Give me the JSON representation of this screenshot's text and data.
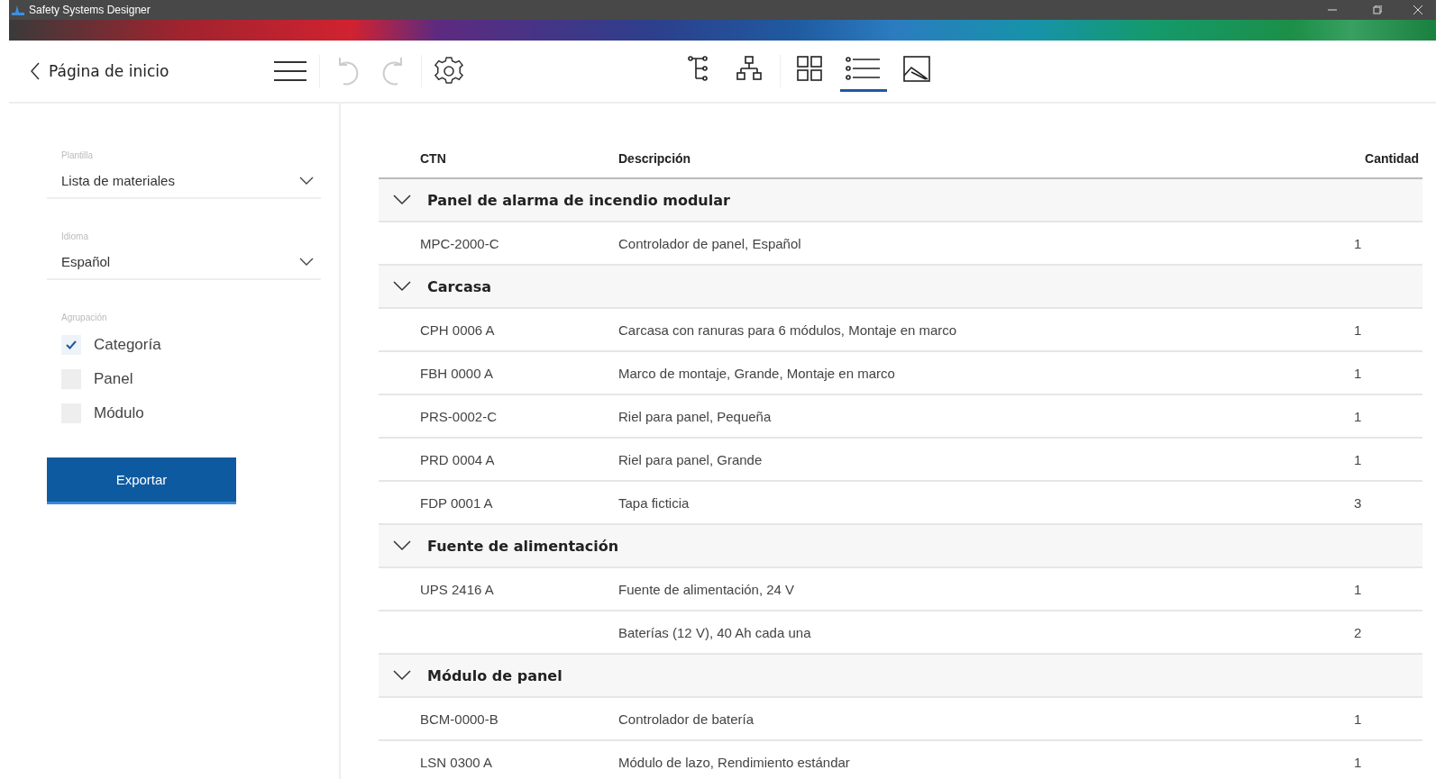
{
  "window": {
    "title": "Safety Systems Designer"
  },
  "toolbar": {
    "back": "Página de inicio",
    "views": [
      {
        "kind": "tree",
        "selected": false
      },
      {
        "kind": "hierarchy",
        "selected": false
      },
      {
        "kind": "grid",
        "selected": false
      },
      {
        "kind": "list",
        "selected": true
      },
      {
        "kind": "image",
        "selected": false
      }
    ]
  },
  "sidebar": {
    "fields": [
      {
        "label": "Plantilla",
        "value": "Lista de materiales"
      },
      {
        "label": "Idioma",
        "value": "Español"
      }
    ],
    "grouping": {
      "label": "Agrupación",
      "options": [
        {
          "label": "Categoría",
          "checked": true
        },
        {
          "label": "Panel",
          "checked": false
        },
        {
          "label": "Módulo",
          "checked": false
        }
      ]
    },
    "export_button": "Exportar"
  },
  "table": {
    "columns": [
      "CTN",
      "Descripción",
      "Cantidad"
    ],
    "groups": [
      {
        "title": "Panel de alarma de incendio modular",
        "expanded": true,
        "rows": [
          [
            "MPC-2000-C",
            "Controlador de panel, Español",
            "1"
          ]
        ]
      },
      {
        "title": "Carcasa",
        "expanded": true,
        "rows": [
          [
            "CPH 0006 A",
            "Carcasa con ranuras para 6 módulos, Montaje en marco",
            "1"
          ],
          [
            "FBH 0000 A",
            "Marco de montaje, Grande, Montaje en marco",
            "1"
          ],
          [
            "PRS-0002-C",
            "Riel para panel, Pequeña",
            "1"
          ],
          [
            "PRD 0004 A",
            "Riel para panel, Grande",
            "1"
          ],
          [
            "FDP 0001 A",
            "Tapa ficticia",
            "3"
          ]
        ]
      },
      {
        "title": "Fuente de alimentación",
        "expanded": true,
        "rows": [
          [
            "UPS 2416 A",
            "Fuente de alimentación, 24 V",
            "1"
          ],
          [
            "",
            "Baterías (12 V), 40 Ah cada una",
            "2"
          ]
        ]
      },
      {
        "title": "Módulo de panel",
        "expanded": true,
        "rows": [
          [
            "BCM-0000-B",
            "Controlador de batería",
            "1"
          ],
          [
            "LSN 0300 A",
            "Módulo de lazo, Rendimiento estándar",
            "1"
          ]
        ]
      }
    ]
  }
}
